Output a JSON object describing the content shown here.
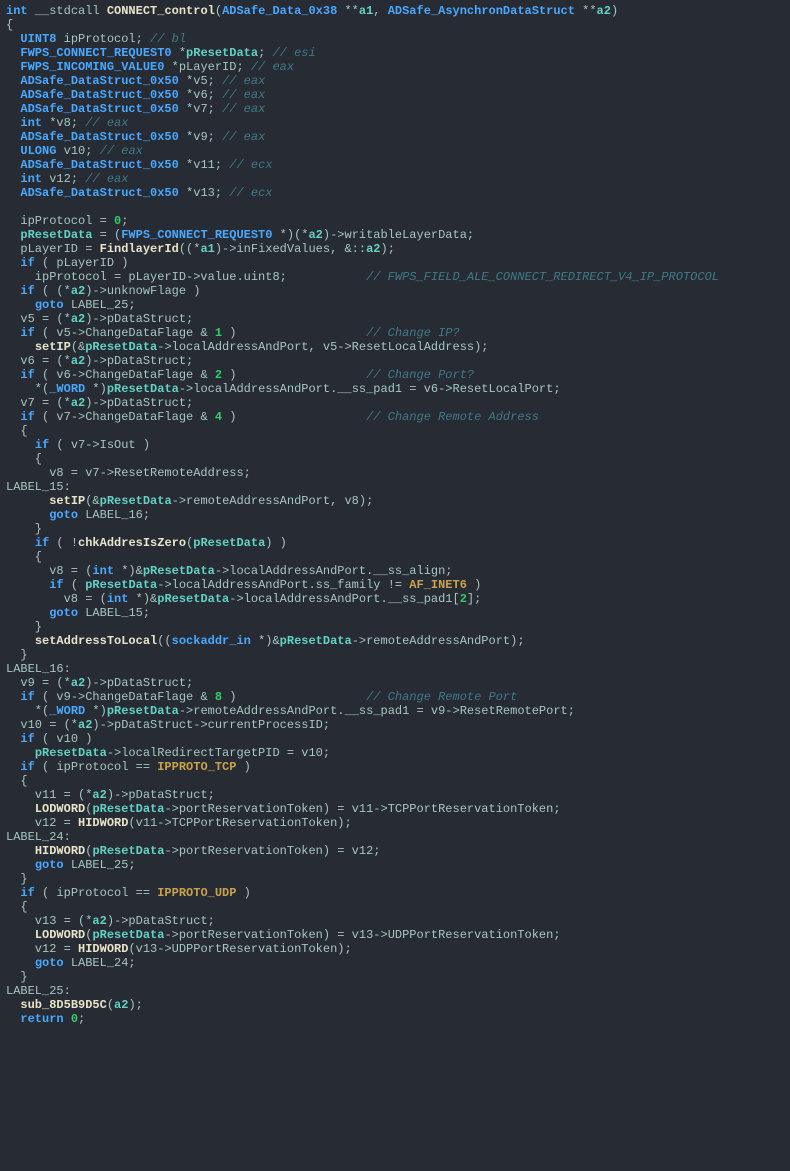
{
  "tokens": [
    [
      [
        "kw",
        "int"
      ],
      [
        "ident",
        " __stdcall "
      ],
      [
        "fn",
        "CONNECT_control"
      ],
      [
        "ident",
        "("
      ],
      [
        "type",
        "ADSafe_Data_0x38"
      ],
      [
        "ident",
        " **"
      ],
      [
        "var",
        "a1"
      ],
      [
        "ident",
        ", "
      ],
      [
        "type",
        "ADSafe_AsynchronDataStruct"
      ],
      [
        "ident",
        " **"
      ],
      [
        "var",
        "a2"
      ],
      [
        "ident",
        ")"
      ]
    ],
    [
      [
        "ident",
        "{"
      ]
    ],
    [
      [
        "ident",
        "  "
      ],
      [
        "type",
        "UINT8"
      ],
      [
        "ident",
        " ipProtocol; "
      ],
      [
        "cmt",
        "// bl"
      ]
    ],
    [
      [
        "ident",
        "  "
      ],
      [
        "type",
        "FWPS_CONNECT_REQUEST0"
      ],
      [
        "ident",
        " *"
      ],
      [
        "var",
        "pResetData"
      ],
      [
        "ident",
        "; "
      ],
      [
        "cmt",
        "// esi"
      ]
    ],
    [
      [
        "ident",
        "  "
      ],
      [
        "type",
        "FWPS_INCOMING_VALUE0"
      ],
      [
        "ident",
        " *pLayerID; "
      ],
      [
        "cmt",
        "// eax"
      ]
    ],
    [
      [
        "ident",
        "  "
      ],
      [
        "type",
        "ADSafe_DataStruct_0x50"
      ],
      [
        "ident",
        " *v5; "
      ],
      [
        "cmt",
        "// eax"
      ]
    ],
    [
      [
        "ident",
        "  "
      ],
      [
        "type",
        "ADSafe_DataStruct_0x50"
      ],
      [
        "ident",
        " *v6; "
      ],
      [
        "cmt",
        "// eax"
      ]
    ],
    [
      [
        "ident",
        "  "
      ],
      [
        "type",
        "ADSafe_DataStruct_0x50"
      ],
      [
        "ident",
        " *v7; "
      ],
      [
        "cmt",
        "// eax"
      ]
    ],
    [
      [
        "ident",
        "  "
      ],
      [
        "kw",
        "int"
      ],
      [
        "ident",
        " *v8; "
      ],
      [
        "cmt",
        "// eax"
      ]
    ],
    [
      [
        "ident",
        "  "
      ],
      [
        "type",
        "ADSafe_DataStruct_0x50"
      ],
      [
        "ident",
        " *v9; "
      ],
      [
        "cmt",
        "// eax"
      ]
    ],
    [
      [
        "ident",
        "  "
      ],
      [
        "type",
        "ULONG"
      ],
      [
        "ident",
        " v10; "
      ],
      [
        "cmt",
        "// eax"
      ]
    ],
    [
      [
        "ident",
        "  "
      ],
      [
        "type",
        "ADSafe_DataStruct_0x50"
      ],
      [
        "ident",
        " *v11; "
      ],
      [
        "cmt",
        "// ecx"
      ]
    ],
    [
      [
        "ident",
        "  "
      ],
      [
        "kw",
        "int"
      ],
      [
        "ident",
        " v12; "
      ],
      [
        "cmt",
        "// eax"
      ]
    ],
    [
      [
        "ident",
        "  "
      ],
      [
        "type",
        "ADSafe_DataStruct_0x50"
      ],
      [
        "ident",
        " *v13; "
      ],
      [
        "cmt",
        "// ecx"
      ]
    ],
    [
      [
        "ident",
        ""
      ]
    ],
    [
      [
        "ident",
        "  ipProtocol = "
      ],
      [
        "num",
        "0"
      ],
      [
        "ident",
        ";"
      ]
    ],
    [
      [
        "ident",
        "  "
      ],
      [
        "var",
        "pResetData"
      ],
      [
        "ident",
        " = ("
      ],
      [
        "type",
        "FWPS_CONNECT_REQUEST0"
      ],
      [
        "ident",
        " *)(*"
      ],
      [
        "var",
        "a2"
      ],
      [
        "ident",
        ")->writableLayerData;"
      ]
    ],
    [
      [
        "ident",
        "  pLayerID = "
      ],
      [
        "fn",
        "FindlayerId"
      ],
      [
        "ident",
        "((*"
      ],
      [
        "var",
        "a1"
      ],
      [
        "ident",
        ")->inFixedValues, &::"
      ],
      [
        "var",
        "a2"
      ],
      [
        "ident",
        ");"
      ]
    ],
    [
      [
        "ident",
        "  "
      ],
      [
        "kw",
        "if"
      ],
      [
        "ident",
        " ( pLayerID )"
      ]
    ],
    [
      [
        "ident",
        "    ipProtocol = pLayerID->value.uint8;           "
      ],
      [
        "cmt",
        "// FWPS_FIELD_ALE_CONNECT_REDIRECT_V4_IP_PROTOCOL"
      ]
    ],
    [
      [
        "ident",
        "  "
      ],
      [
        "kw",
        "if"
      ],
      [
        "ident",
        " ( (*"
      ],
      [
        "var",
        "a2"
      ],
      [
        "ident",
        ")->unknowFlage )"
      ]
    ],
    [
      [
        "ident",
        "    "
      ],
      [
        "kw",
        "goto"
      ],
      [
        "ident",
        " LABEL_25;"
      ]
    ],
    [
      [
        "ident",
        "  v5 = (*"
      ],
      [
        "var",
        "a2"
      ],
      [
        "ident",
        ")->pDataStruct;"
      ]
    ],
    [
      [
        "ident",
        "  "
      ],
      [
        "kw",
        "if"
      ],
      [
        "ident",
        " ( v5->ChangeDataFlage & "
      ],
      [
        "num",
        "1"
      ],
      [
        "ident",
        " )                  "
      ],
      [
        "cmt",
        "// Change IP?"
      ]
    ],
    [
      [
        "ident",
        "    "
      ],
      [
        "fn",
        "setIP"
      ],
      [
        "ident",
        "(&"
      ],
      [
        "var",
        "pResetData"
      ],
      [
        "ident",
        "->localAddressAndPort, v5->ResetLocalAddress);"
      ]
    ],
    [
      [
        "ident",
        "  v6 = (*"
      ],
      [
        "var",
        "a2"
      ],
      [
        "ident",
        ")->pDataStruct;"
      ]
    ],
    [
      [
        "ident",
        "  "
      ],
      [
        "kw",
        "if"
      ],
      [
        "ident",
        " ( v6->ChangeDataFlage & "
      ],
      [
        "num",
        "2"
      ],
      [
        "ident",
        " )                  "
      ],
      [
        "cmt",
        "// Change Port?"
      ]
    ],
    [
      [
        "ident",
        "    *("
      ],
      [
        "type",
        "_WORD"
      ],
      [
        "ident",
        " *)"
      ],
      [
        "var",
        "pResetData"
      ],
      [
        "ident",
        "->localAddressAndPort.__ss_pad1 = v6->ResetLocalPort;"
      ]
    ],
    [
      [
        "ident",
        "  v7 = (*"
      ],
      [
        "var",
        "a2"
      ],
      [
        "ident",
        ")->pDataStruct;"
      ]
    ],
    [
      [
        "ident",
        "  "
      ],
      [
        "kw",
        "if"
      ],
      [
        "ident",
        " ( v7->ChangeDataFlage & "
      ],
      [
        "num",
        "4"
      ],
      [
        "ident",
        " )                  "
      ],
      [
        "cmt",
        "// Change Remote Address"
      ]
    ],
    [
      [
        "ident",
        "  {"
      ]
    ],
    [
      [
        "ident",
        "    "
      ],
      [
        "kw",
        "if"
      ],
      [
        "ident",
        " ( v7->IsOut )"
      ]
    ],
    [
      [
        "ident",
        "    {"
      ]
    ],
    [
      [
        "ident",
        "      v8 = v7->ResetRemoteAddress;"
      ]
    ],
    [
      [
        "ident",
        "LABEL_15:"
      ]
    ],
    [
      [
        "ident",
        "      "
      ],
      [
        "fn",
        "setIP"
      ],
      [
        "ident",
        "(&"
      ],
      [
        "var",
        "pResetData"
      ],
      [
        "ident",
        "->remoteAddressAndPort, v8);"
      ]
    ],
    [
      [
        "ident",
        "      "
      ],
      [
        "kw",
        "goto"
      ],
      [
        "ident",
        " LABEL_16;"
      ]
    ],
    [
      [
        "ident",
        "    }"
      ]
    ],
    [
      [
        "ident",
        "    "
      ],
      [
        "kw",
        "if"
      ],
      [
        "ident",
        " ( !"
      ],
      [
        "fn",
        "chkAddresIsZero"
      ],
      [
        "ident",
        "("
      ],
      [
        "var",
        "pResetData"
      ],
      [
        "ident",
        ") )"
      ]
    ],
    [
      [
        "ident",
        "    {"
      ]
    ],
    [
      [
        "ident",
        "      v8 = ("
      ],
      [
        "kw",
        "int"
      ],
      [
        "ident",
        " *)&"
      ],
      [
        "var",
        "pResetData"
      ],
      [
        "ident",
        "->localAddressAndPort.__ss_align;"
      ]
    ],
    [
      [
        "ident",
        "      "
      ],
      [
        "kw",
        "if"
      ],
      [
        "ident",
        " ( "
      ],
      [
        "var",
        "pResetData"
      ],
      [
        "ident",
        "->localAddressAndPort.ss_family != "
      ],
      [
        "enum",
        "AF_INET6"
      ],
      [
        "ident",
        " )"
      ]
    ],
    [
      [
        "ident",
        "        v8 = ("
      ],
      [
        "kw",
        "int"
      ],
      [
        "ident",
        " *)&"
      ],
      [
        "var",
        "pResetData"
      ],
      [
        "ident",
        "->localAddressAndPort.__ss_pad1["
      ],
      [
        "num",
        "2"
      ],
      [
        "ident",
        "];"
      ]
    ],
    [
      [
        "ident",
        "      "
      ],
      [
        "kw",
        "goto"
      ],
      [
        "ident",
        " LABEL_15;"
      ]
    ],
    [
      [
        "ident",
        "    }"
      ]
    ],
    [
      [
        "ident",
        "    "
      ],
      [
        "fn",
        "setAddressToLocal"
      ],
      [
        "ident",
        "(("
      ],
      [
        "type",
        "sockaddr_in"
      ],
      [
        "ident",
        " *)&"
      ],
      [
        "var",
        "pResetData"
      ],
      [
        "ident",
        "->remoteAddressAndPort);"
      ]
    ],
    [
      [
        "ident",
        "  }"
      ]
    ],
    [
      [
        "ident",
        "LABEL_16:"
      ]
    ],
    [
      [
        "ident",
        "  v9 = (*"
      ],
      [
        "var",
        "a2"
      ],
      [
        "ident",
        ")->pDataStruct;"
      ]
    ],
    [
      [
        "ident",
        "  "
      ],
      [
        "kw",
        "if"
      ],
      [
        "ident",
        " ( v9->ChangeDataFlage & "
      ],
      [
        "num",
        "8"
      ],
      [
        "ident",
        " )                  "
      ],
      [
        "cmt",
        "// Change Remote Port"
      ]
    ],
    [
      [
        "ident",
        "    *("
      ],
      [
        "type",
        "_WORD"
      ],
      [
        "ident",
        " *)"
      ],
      [
        "var",
        "pResetData"
      ],
      [
        "ident",
        "->remoteAddressAndPort.__ss_pad1 = v9->ResetRemotePort;"
      ]
    ],
    [
      [
        "ident",
        "  v10 = (*"
      ],
      [
        "var",
        "a2"
      ],
      [
        "ident",
        ")->pDataStruct->currentProcessID;"
      ]
    ],
    [
      [
        "ident",
        "  "
      ],
      [
        "kw",
        "if"
      ],
      [
        "ident",
        " ( v10 )"
      ]
    ],
    [
      [
        "ident",
        "    "
      ],
      [
        "var",
        "pResetData"
      ],
      [
        "ident",
        "->localRedirectTargetPID = v10;"
      ]
    ],
    [
      [
        "ident",
        "  "
      ],
      [
        "kw",
        "if"
      ],
      [
        "ident",
        " ( ipProtocol == "
      ],
      [
        "enum",
        "IPPROTO_TCP"
      ],
      [
        "ident",
        " )"
      ]
    ],
    [
      [
        "ident",
        "  {"
      ]
    ],
    [
      [
        "ident",
        "    v11 = (*"
      ],
      [
        "var",
        "a2"
      ],
      [
        "ident",
        ")->pDataStruct;"
      ]
    ],
    [
      [
        "ident",
        "    "
      ],
      [
        "fn",
        "LODWORD"
      ],
      [
        "ident",
        "("
      ],
      [
        "var",
        "pResetData"
      ],
      [
        "ident",
        "->portReservationToken) = v11->TCPPortReservationToken;"
      ]
    ],
    [
      [
        "ident",
        "    v12 = "
      ],
      [
        "fn",
        "HIDWORD"
      ],
      [
        "ident",
        "(v11->TCPPortReservationToken);"
      ]
    ],
    [
      [
        "ident",
        "LABEL_24:"
      ]
    ],
    [
      [
        "ident",
        "    "
      ],
      [
        "fn",
        "HIDWORD"
      ],
      [
        "ident",
        "("
      ],
      [
        "var",
        "pResetData"
      ],
      [
        "ident",
        "->portReservationToken) = v12;"
      ]
    ],
    [
      [
        "ident",
        "    "
      ],
      [
        "kw",
        "goto"
      ],
      [
        "ident",
        " LABEL_25;"
      ]
    ],
    [
      [
        "ident",
        "  }"
      ]
    ],
    [
      [
        "ident",
        "  "
      ],
      [
        "kw",
        "if"
      ],
      [
        "ident",
        " ( ipProtocol == "
      ],
      [
        "enum",
        "IPPROTO_UDP"
      ],
      [
        "ident",
        " )"
      ]
    ],
    [
      [
        "ident",
        "  {"
      ]
    ],
    [
      [
        "ident",
        "    v13 = (*"
      ],
      [
        "var",
        "a2"
      ],
      [
        "ident",
        ")->pDataStruct;"
      ]
    ],
    [
      [
        "ident",
        "    "
      ],
      [
        "fn",
        "LODWORD"
      ],
      [
        "ident",
        "("
      ],
      [
        "var",
        "pResetData"
      ],
      [
        "ident",
        "->portReservationToken) = v13->UDPPortReservationToken;"
      ]
    ],
    [
      [
        "ident",
        "    v12 = "
      ],
      [
        "fn",
        "HIDWORD"
      ],
      [
        "ident",
        "(v13->UDPPortReservationToken);"
      ]
    ],
    [
      [
        "ident",
        "    "
      ],
      [
        "kw",
        "goto"
      ],
      [
        "ident",
        " LABEL_24;"
      ]
    ],
    [
      [
        "ident",
        "  }"
      ]
    ],
    [
      [
        "ident",
        "LABEL_25:"
      ]
    ],
    [
      [
        "ident",
        "  "
      ],
      [
        "fn",
        "sub_8D5B9D5C"
      ],
      [
        "ident",
        "("
      ],
      [
        "var",
        "a2"
      ],
      [
        "ident",
        ");"
      ]
    ],
    [
      [
        "ident",
        "  "
      ],
      [
        "kw",
        "return"
      ],
      [
        "ident",
        " "
      ],
      [
        "num",
        "0"
      ],
      [
        "ident",
        ";"
      ]
    ]
  ]
}
